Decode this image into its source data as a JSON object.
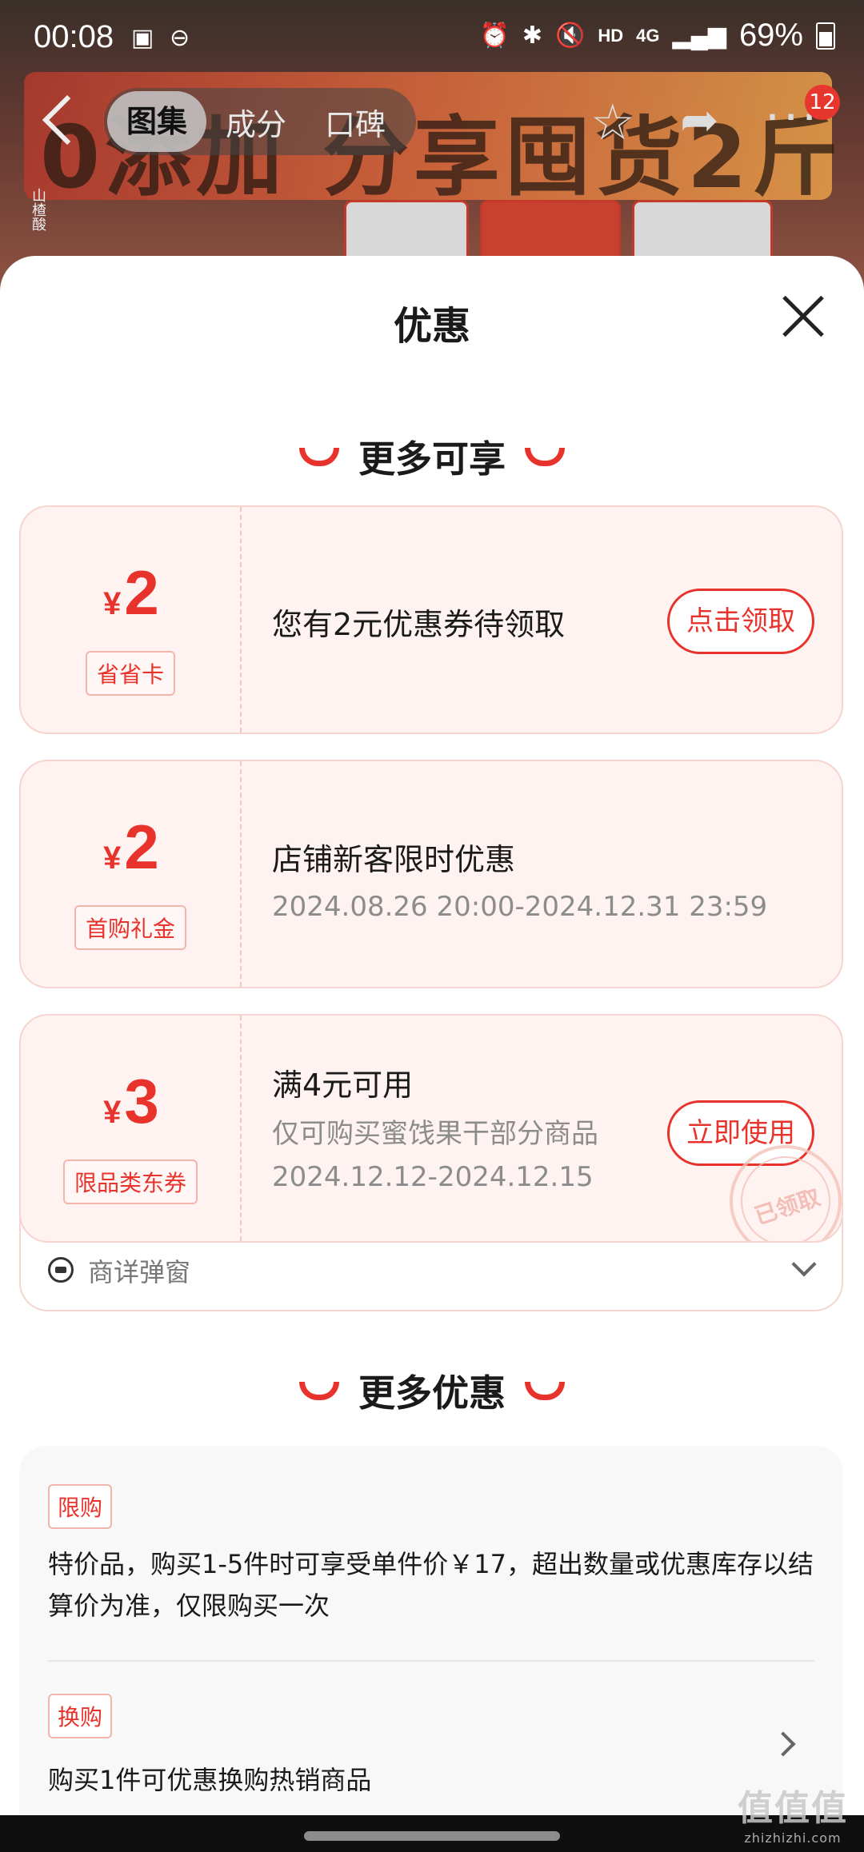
{
  "status_bar": {
    "time": "00:08",
    "network": "4G",
    "hd": "HD",
    "battery": "69%"
  },
  "product_page": {
    "tabs": [
      "图集",
      "成分",
      "口碑"
    ],
    "active_tab": "图集",
    "banner_text": "0添加 分享囤货2斤",
    "side_text": "山楂酸",
    "notification_count": "12"
  },
  "sheet": {
    "title": "优惠",
    "section1": "更多可享",
    "section2": "更多优惠",
    "coupons": [
      {
        "currency": "¥",
        "amount": "2",
        "tag": "省省卡",
        "title": "您有2元优惠券待领取",
        "button": "点击领取"
      },
      {
        "currency": "¥",
        "amount": "2",
        "tag": "首购礼金",
        "title": "店铺新客限时优惠",
        "validity": "2024.08.26 20:00-2024.12.31 23:59"
      },
      {
        "currency": "¥",
        "amount": "3",
        "tag": "限品类东券",
        "title": "满4元可用",
        "scope": "仅可购买蜜饯果干部分商品",
        "validity": "2024.12.12-2024.12.15",
        "button": "立即使用",
        "stamp": "已领取"
      }
    ],
    "coupon_footer": "商详弹窗",
    "offers": [
      {
        "tag": "限购",
        "text": "特价品，购买1-5件时可享受单件价￥17，超出数量或优惠库存以结算价为准，仅限购买一次"
      },
      {
        "tag": "换购",
        "text": "购买1件可优惠换购热销商品"
      }
    ]
  },
  "watermark": {
    "main": "值值值",
    "sub": "zhizhizhi.com"
  },
  "colors": {
    "accent": "#e8332c",
    "coupon_bg": "#fff3f1",
    "coupon_border": "#f6d4cf"
  }
}
